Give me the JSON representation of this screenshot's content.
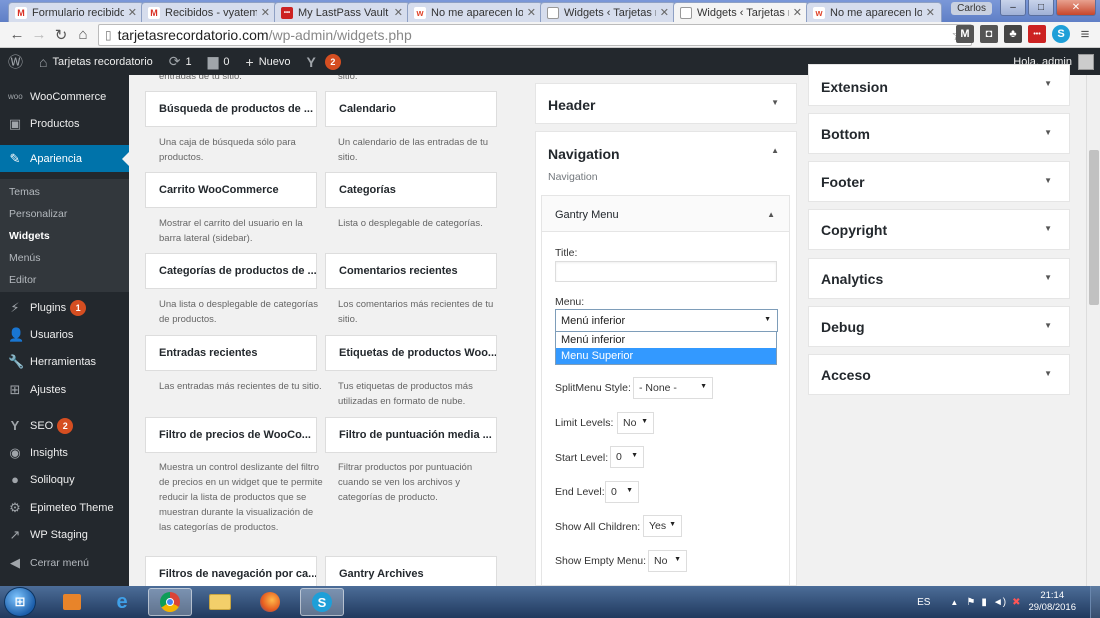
{
  "browser": {
    "tabs": [
      {
        "label": "Formulario recibido",
        "favicon": "M",
        "color": "#d93025"
      },
      {
        "label": "Recibidos - vyateme",
        "favicon": "M",
        "color": "#d93025"
      },
      {
        "label": "My LastPass Vault",
        "favicon": "•••",
        "color": "#cc2222"
      },
      {
        "label": "No me aparecen los",
        "favicon": "w",
        "color": "#e0462c"
      },
      {
        "label": "Widgets ‹ Tarjetas re",
        "favicon": "",
        "color": "#888888"
      },
      {
        "label": "Widgets ‹ Tarjetas re",
        "favicon": "",
        "color": "#888888"
      },
      {
        "label": "No me aparecen los",
        "favicon": "w",
        "color": "#e0462c"
      }
    ],
    "user_badge": "Carlos",
    "url_host": "tarjetasrecordatorio.com",
    "url_path": "/wp-admin/widgets.php"
  },
  "adminbar": {
    "site_name": "Tarjetas recordatorio",
    "updates_count": "1",
    "comments_count": "0",
    "new_label": "Nuevo",
    "seo_count": "2",
    "greeting": "Hola, admin"
  },
  "sidebar": {
    "items_top": [
      "WooCommerce",
      "Productos"
    ],
    "current": "Apariencia",
    "submenu": [
      "Temas",
      "Personalizar",
      "Widgets",
      "Menús",
      "Editor"
    ],
    "items_bottom": [
      {
        "label": "Plugins",
        "badge": "1"
      },
      {
        "label": "Usuarios"
      },
      {
        "label": "Herramientas"
      },
      {
        "label": "Ajustes"
      },
      {
        "label": "SEO",
        "badge": "2"
      },
      {
        "label": "Insights"
      },
      {
        "label": "Soliloquy"
      },
      {
        "label": "Epimeteo Theme"
      },
      {
        "label": "WP Staging"
      },
      {
        "label": "Cerrar menú"
      }
    ]
  },
  "widgets": {
    "top_desc_left": "entradas de tu sitio.",
    "top_desc_right": "sitio.",
    "rows": [
      {
        "left": {
          "title": "Búsqueda de productos de ...",
          "desc": "Una caja de búsqueda sólo para productos."
        },
        "right": {
          "title": "Calendario",
          "desc": "Un calendario de las entradas de tu sitio."
        }
      },
      {
        "left": {
          "title": "Carrito WooCommerce",
          "desc": "Mostrar el carrito del usuario en la barra lateral (sidebar)."
        },
        "right": {
          "title": "Categorías",
          "desc": "Lista o desplegable de categorías."
        }
      },
      {
        "left": {
          "title": "Categorías de productos de ...",
          "desc": "Una lista o desplegable de categorías de productos."
        },
        "right": {
          "title": "Comentarios recientes",
          "desc": "Los comentarios más recientes de tu sitio."
        }
      },
      {
        "left": {
          "title": "Entradas recientes",
          "desc": "Las entradas más recientes de tu sitio."
        },
        "right": {
          "title": "Etiquetas de productos Woo...",
          "desc": "Tus etiquetas de productos más utilizadas en formato de nube."
        }
      },
      {
        "left": {
          "title": "Filtro de precios de WooCo...",
          "desc": "Muestra un control deslizante del filtro de precios en un widget que te permite reducir la lista de productos que se muestran durante la visualización de las categorías de productos."
        },
        "right": {
          "title": "Filtro de puntuación media ...",
          "desc": "Filtrar productos por puntuación cuando se ven los archivos y categorías de producto."
        }
      },
      {
        "left": {
          "title": "Filtros de navegación por ca...",
          "desc": ""
        },
        "right": {
          "title": "Gantry Archives",
          "desc": ""
        }
      }
    ]
  },
  "areas": {
    "header": "Header",
    "navigation": "Navigation",
    "navigation_desc": "Navigation",
    "right": [
      "Extension",
      "Bottom",
      "Footer",
      "Copyright",
      "Analytics",
      "Debug",
      "Acceso"
    ]
  },
  "gantry_menu": {
    "title": "Gantry Menu",
    "title_label": "Title:",
    "title_value": "",
    "menu_label": "Menu:",
    "menu_value": "Menú inferior",
    "menu_options": [
      "Menú inferior",
      "Menu Superior"
    ],
    "menu_highlighted": "Menu Superior",
    "splitmenu_label": "SplitMenu Style:",
    "splitmenu_value": "- None -",
    "limit_label": "Limit Levels:",
    "limit_value": "No",
    "start_label": "Start Level:",
    "start_value": "0",
    "end_label": "End Level:",
    "end_value": "0",
    "show_children_label": "Show All Children:",
    "show_children_value": "Yes",
    "show_empty_label": "Show Empty Menu:",
    "show_empty_value": "No"
  },
  "taskbar": {
    "lang": "ES",
    "time": "21:14",
    "date": "29/08/2016"
  },
  "colors": {
    "wp_dark": "#23282d",
    "wp_blue": "#0073aa",
    "badge": "#d54e21",
    "selection": "#3399ff"
  }
}
